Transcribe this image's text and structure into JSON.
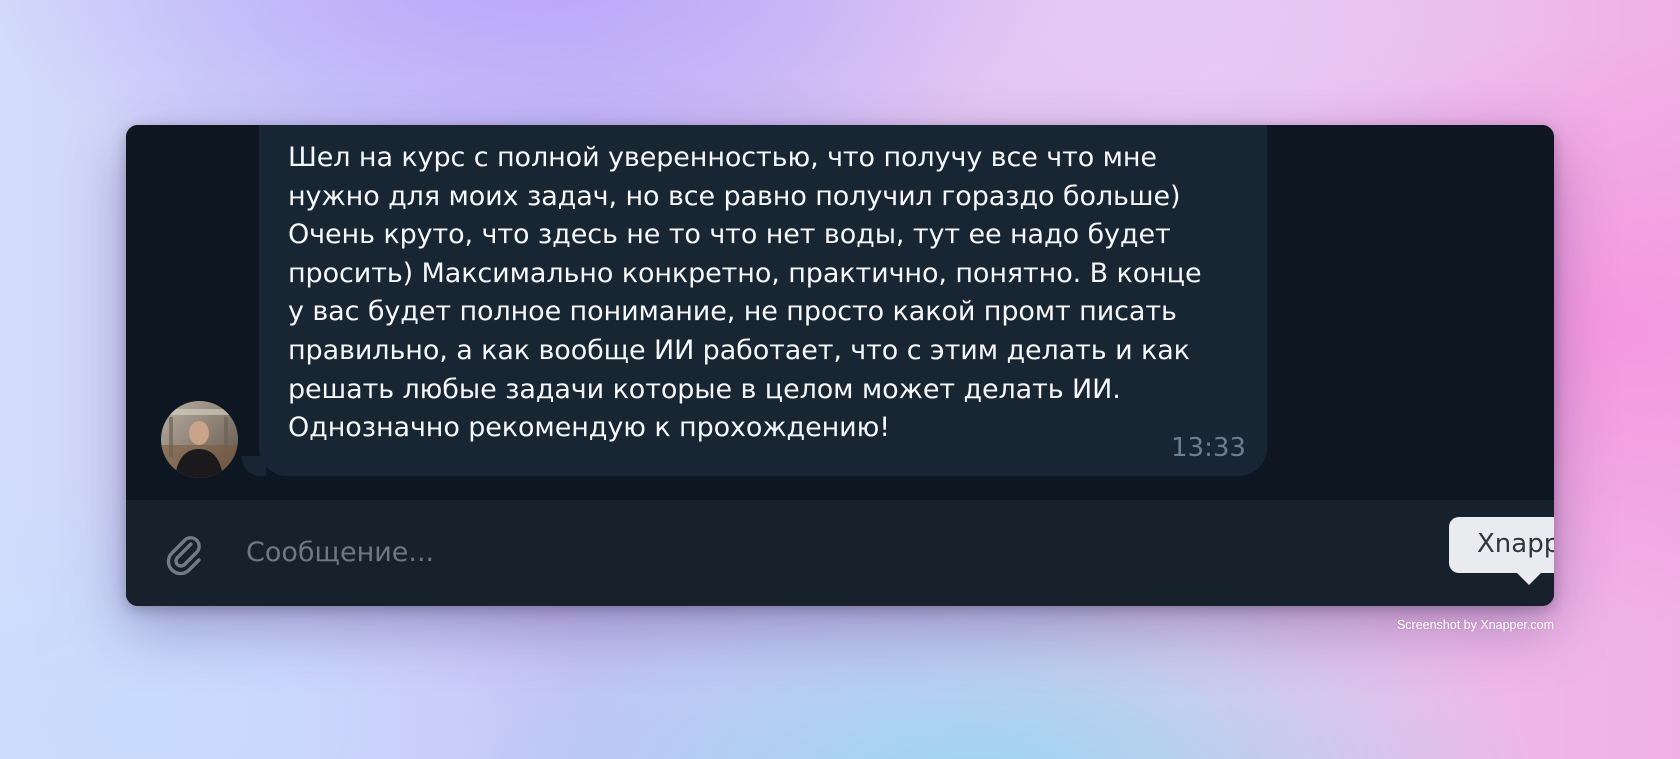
{
  "chat": {
    "message": {
      "text": "Шел на курс с полной уверенностью, что получу все что мне\nнужно для моих задач, но все равно получил гораздо больше)\nОчень круто, что здесь не то что нет воды, тут ее надо будет\nпросить) Максимально конкретно, практично, понятно. В конце\nу вас будет полное понимание, не просто какой промт писать\nправильно, а как вообще ИИ работает, что с этим делать и как\nрешать любые задачи которые в целом может делать ИИ.\nОднозначно рекомендую к прохождению!",
      "time": "13:33"
    }
  },
  "composer": {
    "placeholder": "Сообщение...",
    "attach_icon": "paperclip-icon"
  },
  "tooltip": {
    "label": "Xnapper"
  },
  "watermark": "Screenshot by Xnapper.com",
  "colors": {
    "window_bg": "#0e1621",
    "bubble_bg": "#182533",
    "composer_bg": "#17212b",
    "text": "#f5f7fa",
    "time": "#6d7f8f"
  }
}
